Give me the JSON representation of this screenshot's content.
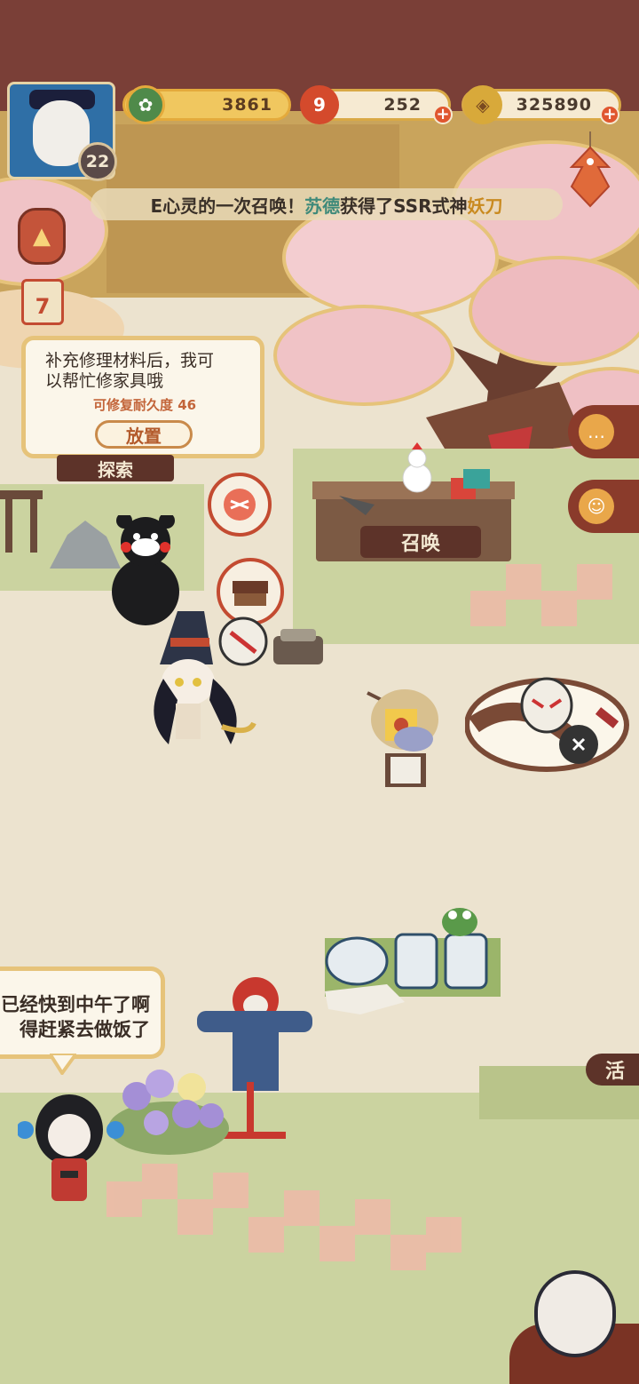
{
  "player": {
    "level": "22"
  },
  "resources": {
    "jade": "3861",
    "summon_stone": "252",
    "coins": "325890",
    "plus": "+"
  },
  "ticker": {
    "prefix": "E心灵的一次召唤！",
    "player_name": "苏德",
    "middle": "获得了SSR式神",
    "shikigami": "妖刀"
  },
  "calendar": {
    "day": "7"
  },
  "repair_bubble": {
    "text": "补充修理材料后，我可\n以帮忙修家具哦",
    "durability_label": "可修复耐久度",
    "durability_value": "46",
    "place_button": "放置"
  },
  "labels": {
    "explore": "探索",
    "summon": "召唤",
    "activity": "活"
  },
  "npc_bubble": {
    "text": "已经快到中午了啊\n得赶紧去做饭了"
  },
  "colors": {
    "banner": "#7a3f37",
    "gold": "#c9a45c",
    "sakura": "#f0c3c6",
    "grass": "#cbd3a0",
    "label_bg": "#5d3329"
  },
  "icons": {
    "jade": "pine-jade-icon",
    "stone": "magatama-icon",
    "coin": "gold-coin-icon",
    "fish": "carp-streamer-icon",
    "lantern": "arrow-up-lantern-icon",
    "chat": "chat-icon",
    "doll": "doll-icon"
  }
}
